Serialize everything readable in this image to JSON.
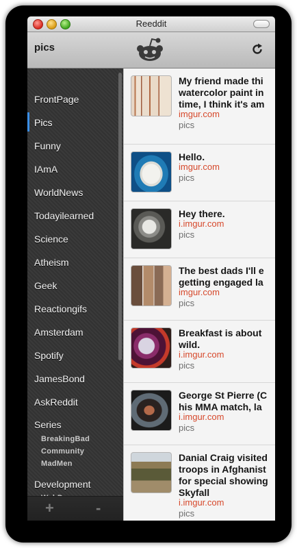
{
  "window": {
    "title": "Reeddit"
  },
  "header": {
    "subreddit": "pics"
  },
  "sidebar": {
    "items": [
      {
        "label": "FrontPage"
      },
      {
        "label": "Pics"
      },
      {
        "label": "Funny"
      },
      {
        "label": "IAmA"
      },
      {
        "label": "WorldNews"
      },
      {
        "label": "Todayilearned"
      },
      {
        "label": "Science"
      },
      {
        "label": "Atheism"
      },
      {
        "label": "Geek"
      },
      {
        "label": "Reactiongifs"
      },
      {
        "label": "Amsterdam"
      },
      {
        "label": "Spotify"
      },
      {
        "label": "JamesBond"
      },
      {
        "label": "AskReddit"
      }
    ],
    "active": "Pics",
    "groups": [
      {
        "label": "Series",
        "children": [
          "BreakingBad",
          "Community",
          "MadMen"
        ]
      },
      {
        "label": "Development",
        "children": [
          "WebDev"
        ]
      }
    ],
    "footer": {
      "add": "+",
      "remove": "-"
    }
  },
  "posts": [
    {
      "title_lines": [
        "My friend made thi",
        "watercolor paint in",
        "time, I think it's am"
      ],
      "domain": "imgur.com",
      "subreddit": "pics"
    },
    {
      "title_lines": [
        "Hello."
      ],
      "domain": "imgur.com",
      "subreddit": "pics"
    },
    {
      "title_lines": [
        "Hey there."
      ],
      "domain": "i.imgur.com",
      "subreddit": "pics"
    },
    {
      "title_lines": [
        "The best dads I'll e",
        "getting engaged la"
      ],
      "domain": "imgur.com",
      "subreddit": "pics"
    },
    {
      "title_lines": [
        "Breakfast is about",
        "wild."
      ],
      "domain": "i.imgur.com",
      "subreddit": "pics"
    },
    {
      "title_lines": [
        "George St Pierre (C",
        "his MMA match, la"
      ],
      "domain": "i.imgur.com",
      "subreddit": "pics"
    },
    {
      "title_lines": [
        "Danial Craig visited",
        "troops in Afghanist",
        "for special showing",
        "Skyfall"
      ],
      "domain": "i.imgur.com",
      "subreddit": "pics"
    }
  ],
  "icons": {
    "logo": "reddit-alien-icon",
    "refresh": "refresh-icon"
  },
  "colors": {
    "accent": "#3a8ee6",
    "domain": "#d6482b",
    "sidebar": "#353535"
  }
}
